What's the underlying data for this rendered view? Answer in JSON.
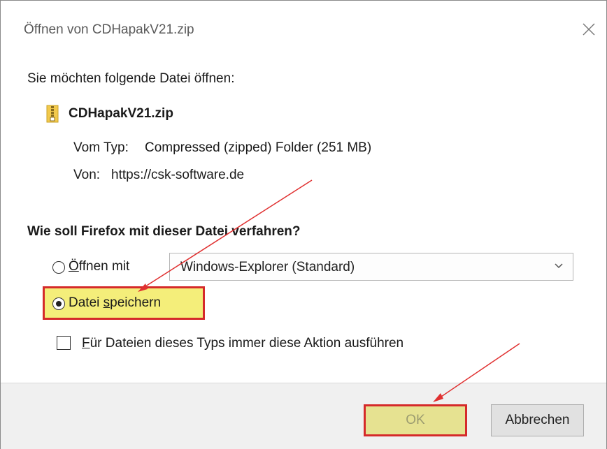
{
  "dialog": {
    "title": "Öffnen von CDHapakV21.zip",
    "intro": "Sie möchten folgende Datei öffnen:",
    "file_name": "CDHapakV21.zip",
    "type_label": "Vom Typ:",
    "type_value": "Compressed (zipped) Folder (251 MB)",
    "from_label": "Von:",
    "from_value": "https://csk-software.de",
    "question": "Wie soll Firefox mit dieser Datei verfahren?"
  },
  "options": {
    "open_with": {
      "label_first_char": "Ö",
      "label_rest": "ffnen mit",
      "selected": false
    },
    "app_select": {
      "value": "Windows-Explorer (Standard)"
    },
    "save_file": {
      "label_prefix": "Datei ",
      "label_mnemonic": "s",
      "label_rest": "peichern",
      "selected": true
    },
    "always": {
      "label_mnemonic": "F",
      "label_rest": "ür Dateien dieses Typs immer diese Aktion ausführen",
      "checked": false
    }
  },
  "buttons": {
    "ok": "OK",
    "cancel": "Abbrechen"
  },
  "colors": {
    "highlight_border": "#d52a2a",
    "highlight_fill": "#f4ee7a",
    "arrow": "#e03030"
  },
  "icons": {
    "close": "close-icon",
    "file": "zip-file-icon",
    "dropdown": "chevron-down-icon"
  }
}
